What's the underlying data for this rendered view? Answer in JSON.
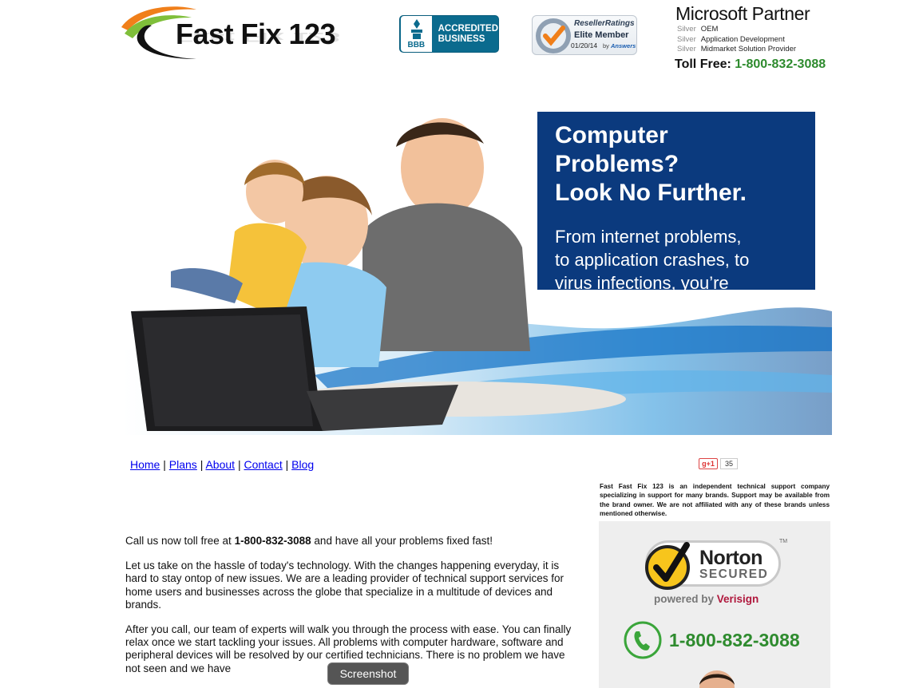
{
  "header": {
    "logo_text": "Fast Fix 123",
    "bbb": {
      "brand": "BBB",
      "line1": "ACCREDITED",
      "line2": "BUSINESS"
    },
    "reseller": {
      "title": "ResellerRatings",
      "status": "Elite Member",
      "date": "01/20/14",
      "by": "by",
      "by_brand": "Answers"
    },
    "ms_partner": {
      "title": "Microsoft Partner",
      "competencies": [
        {
          "level": "Silver",
          "name": "OEM"
        },
        {
          "level": "Silver",
          "name": "Application Development"
        },
        {
          "level": "Silver",
          "name": "Midmarket Solution Provider"
        }
      ]
    },
    "toll_free_label": "Toll Free:",
    "toll_free_number": "1-800-832-3088"
  },
  "hero": {
    "headline_line1": "Computer Problems?",
    "headline_line2": "Look No Further.",
    "sub_line1": "From internet problems,",
    "sub_line2": "to application crashes, to",
    "sub_line3": "virus infections, you’re covered."
  },
  "nav": {
    "items": [
      {
        "label": "Home"
      },
      {
        "label": "Plans"
      },
      {
        "label": "About"
      },
      {
        "label": "Contact"
      },
      {
        "label": "Blog"
      }
    ],
    "separator": "|"
  },
  "social": {
    "gplus_label": "g+1",
    "gplus_count": "35"
  },
  "sidebar": {
    "disclaimer": "Fast Fast Fix 123 is an independent technical support company specializing in support for many brands. Support may be available from the brand owner. We are not affiliated with any of these brands unless mentioned otherwise.",
    "norton_word": "Norton",
    "norton_secured": "SECURED",
    "norton_tm": "TM",
    "powered_by": "powered by",
    "powered_brand": "Verisign",
    "phone": "1-800-832-3088"
  },
  "content": {
    "p1_prefix": "Call us now toll free at",
    "p1_number": "1-800-832-3088",
    "p1_suffix": "and have all your problems fixed fast!",
    "p2": "Let us take on the hassle of today's technology. With the changes happening everyday, it is hard to stay ontop of new issues. We are a leading provider of technical support services for home users and businesses across the globe that specialize in a multitude of devices and brands.",
    "p3": "After you call, our team of experts will walk you through the process with ease. You can finally relax once we start tackling your issues. All problems with computer hardware, software and peripheral devices will be resolved by our certified technicians. There is no problem we have not seen and we have"
  },
  "tooltip": {
    "label": "Screenshot"
  },
  "colors": {
    "accent_green": "#2e8b2e",
    "promo_blue": "#0b3a7e",
    "bbb_teal": "#0b6b8e",
    "link_blue": "#0000ee"
  }
}
